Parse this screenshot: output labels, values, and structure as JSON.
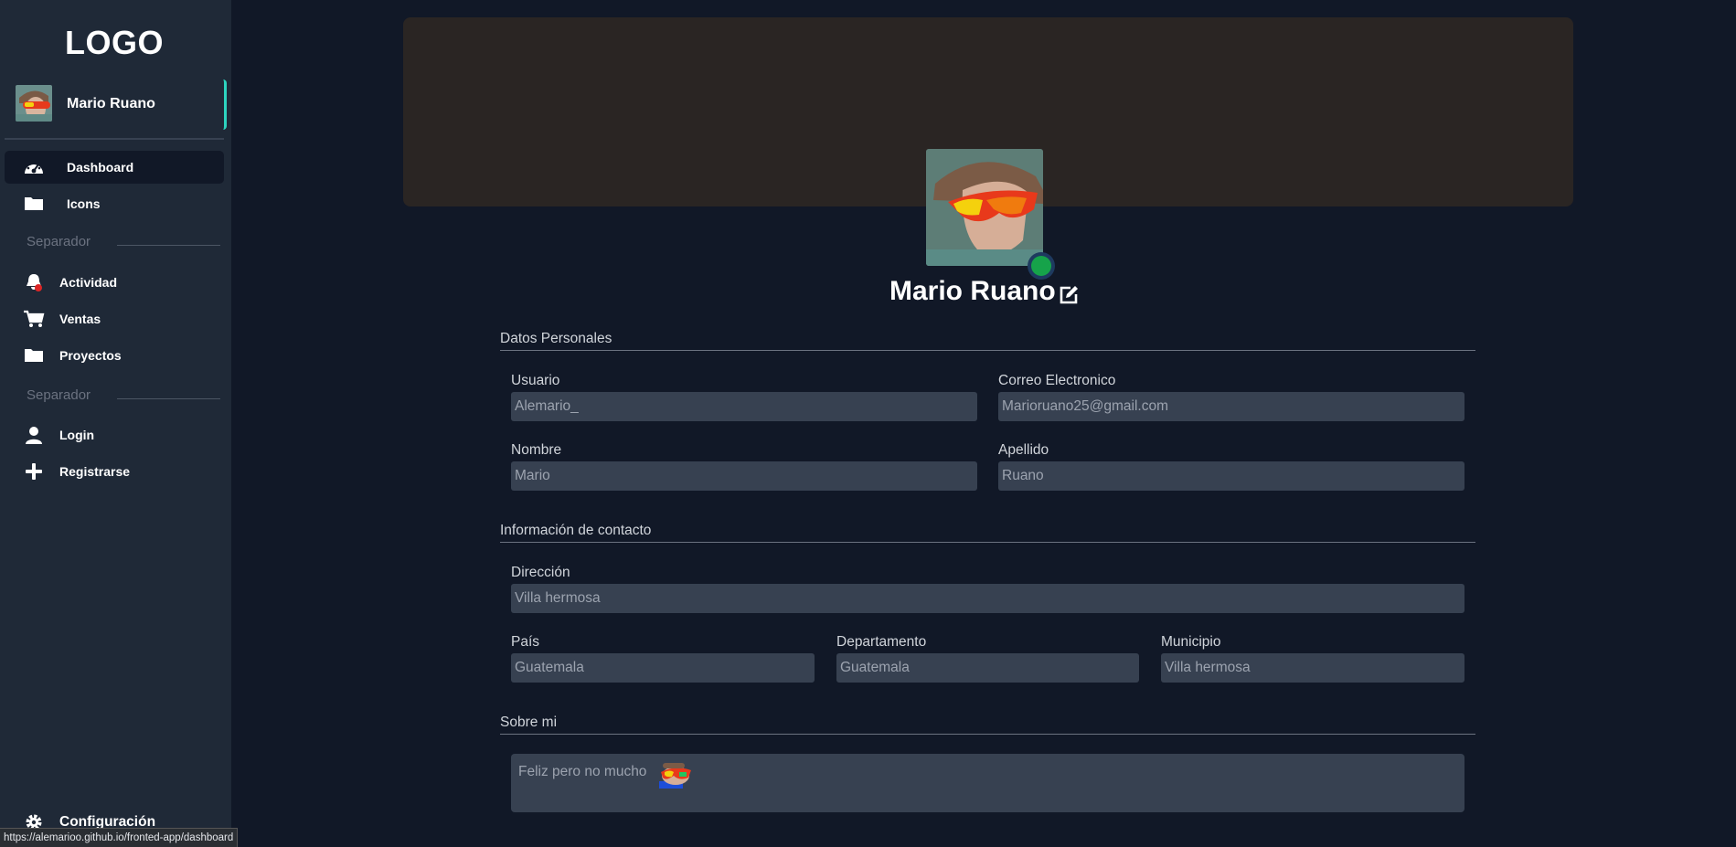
{
  "sidebar": {
    "logo": "LOGO",
    "user_name": "Mario Ruano",
    "items": [
      {
        "label": "Dashboard",
        "icon": "dashboard-gauge-icon"
      },
      {
        "label": "Icons",
        "icon": "folder-icon"
      },
      {
        "label": "Actividad",
        "icon": "bell-icon"
      },
      {
        "label": "Ventas",
        "icon": "cart-icon"
      },
      {
        "label": "Proyectos",
        "icon": "folder-icon"
      },
      {
        "label": "Login",
        "icon": "user-icon"
      },
      {
        "label": "Registrarse",
        "icon": "plus-icon"
      }
    ],
    "separators": [
      "Separador",
      "Separador"
    ],
    "config_label": "Configuración"
  },
  "status_url": "https://alemarioo.github.io/fronted-app/dashboard",
  "profile": {
    "name": "Mario Ruano",
    "online": true
  },
  "sections": {
    "personal": {
      "title": "Datos Personales",
      "usuario_label": "Usuario",
      "usuario_value": "Alemario_",
      "correo_label": "Correo Electronico",
      "correo_value": "Marioruano25@gmail.com",
      "nombre_label": "Nombre",
      "nombre_value": "Mario",
      "apellido_label": "Apellido",
      "apellido_value": "Ruano"
    },
    "contact": {
      "title": "Información de contacto",
      "direccion_label": "Dirección",
      "direccion_value": "Villa hermosa",
      "pais_label": "País",
      "pais_value": "Guatemala",
      "departamento_label": "Departamento",
      "departamento_value": "Guatemala",
      "municipio_label": "Municipio",
      "municipio_value": "Villa hermosa"
    },
    "about": {
      "title": "Sobre mi",
      "text": "Feliz pero no mucho"
    }
  },
  "colors": {
    "accent": "#2dd4bf",
    "online": "#16a34a",
    "background": "#111827",
    "sidebar": "#1f2937"
  }
}
